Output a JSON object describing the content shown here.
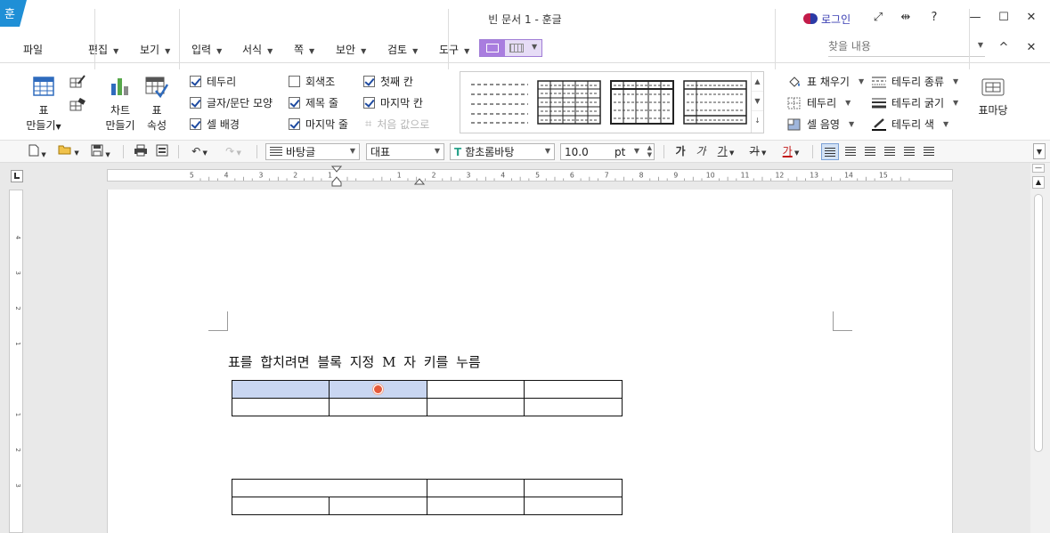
{
  "window": {
    "title": "빈 문서 1 - 훈글",
    "logo_text": "훈",
    "login_label": "로그인",
    "controls": [
      "⤢",
      "⇹",
      "?",
      "—",
      "☐",
      "✕"
    ]
  },
  "menu": {
    "items": [
      {
        "label": "파일",
        "has_dropdown": false
      },
      {
        "label": "편집",
        "has_dropdown": true
      },
      {
        "label": "보기",
        "has_dropdown": true
      },
      {
        "label": "입력",
        "has_dropdown": true
      },
      {
        "label": "서식",
        "has_dropdown": true
      },
      {
        "label": "쪽",
        "has_dropdown": true
      },
      {
        "label": "보안",
        "has_dropdown": true
      },
      {
        "label": "검토",
        "has_dropdown": true
      },
      {
        "label": "도구",
        "has_dropdown": true
      }
    ],
    "find_placeholder": "찾을 내용",
    "ribbon_toggle": "^",
    "close": "✕"
  },
  "ribbon": {
    "table_create_label": "표",
    "table_create_sub": "만들기",
    "chart_create_label": "차트",
    "chart_create_sub": "만들기",
    "table_props_label": "표",
    "table_props_sub": "속성",
    "checkboxes": [
      {
        "label": "테두리",
        "checked": true
      },
      {
        "label": "글자/문단 모양",
        "checked": true
      },
      {
        "label": "셀 배경",
        "checked": true
      },
      {
        "label": "회색조",
        "checked": false
      },
      {
        "label": "제목 줄",
        "checked": true
      },
      {
        "label": "마지막 줄",
        "checked": true
      },
      {
        "label": "첫째 칸",
        "checked": true
      },
      {
        "label": "마지막 칸",
        "checked": true
      }
    ],
    "reset_label": "처음 값으로",
    "right_items": [
      {
        "label": "표 채우기"
      },
      {
        "label": "테두리"
      },
      {
        "label": "셀 음영"
      },
      {
        "label": "테두리 종류"
      },
      {
        "label": "테두리 굵기"
      },
      {
        "label": "테두리 색"
      }
    ],
    "table_styles_label": "표마당"
  },
  "format_bar": {
    "style": "바탕글",
    "outline": "대표",
    "font": "함초롬바탕",
    "font_size": "10.0",
    "size_unit": "pt",
    "bold": "가",
    "italic": "가",
    "underline": "가",
    "strike": "가",
    "color": "가"
  },
  "ruler": {
    "h_numbers": [
      "5",
      "4",
      "3",
      "2",
      "1",
      "",
      "1",
      "2",
      "3",
      "4",
      "5",
      "6",
      "7",
      "8",
      "9",
      "10",
      "11",
      "12",
      "13",
      "14",
      "15"
    ],
    "v_numbers": [
      "4",
      "3",
      "2",
      "1",
      "",
      "1",
      "2",
      "3"
    ]
  },
  "document": {
    "text": "표를 합치려면 블록 지정 M 자 키를 누름"
  }
}
